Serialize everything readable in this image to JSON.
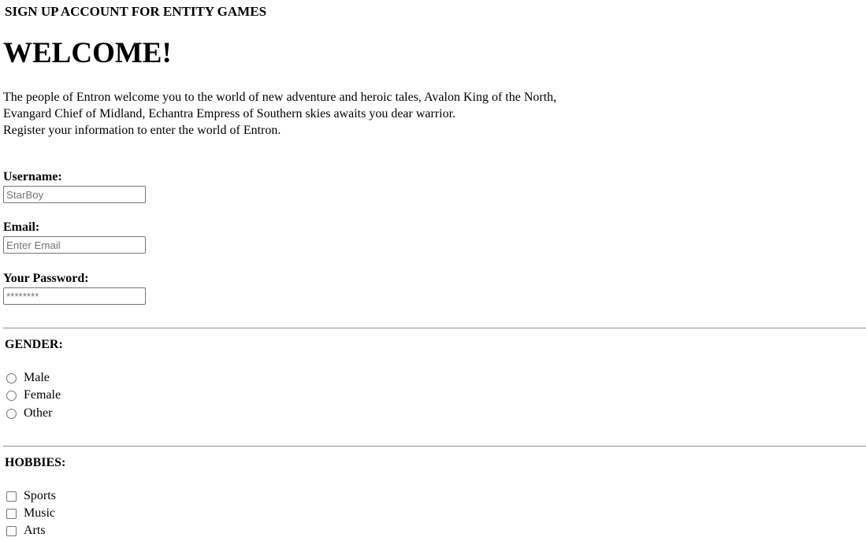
{
  "header": {
    "top_title": "SIGN UP ACCOUNT FOR ENTITY GAMES",
    "welcome": "WELCOME!"
  },
  "intro": {
    "lines": [
      "The people of Entron welcome you to the world of new adventure and heroic tales, Avalon King of the North,",
      "Evangard Chief of Midland, Echantra Empress of Southern skies awaits you dear warrior.",
      "Register your information to enter the world of Entron."
    ]
  },
  "form": {
    "username": {
      "label": "Username:",
      "placeholder": "StarBoy",
      "value": ""
    },
    "email": {
      "label": "Email:",
      "placeholder": "Enter Email",
      "value": ""
    },
    "password": {
      "label": "Your Password:",
      "placeholder": "********",
      "value": ""
    }
  },
  "gender": {
    "title": "GENDER:",
    "options": [
      "Male",
      "Female",
      "Other"
    ]
  },
  "hobbies": {
    "title": "HOBBIES:",
    "options": [
      "Sports",
      "Music",
      "Arts"
    ]
  }
}
